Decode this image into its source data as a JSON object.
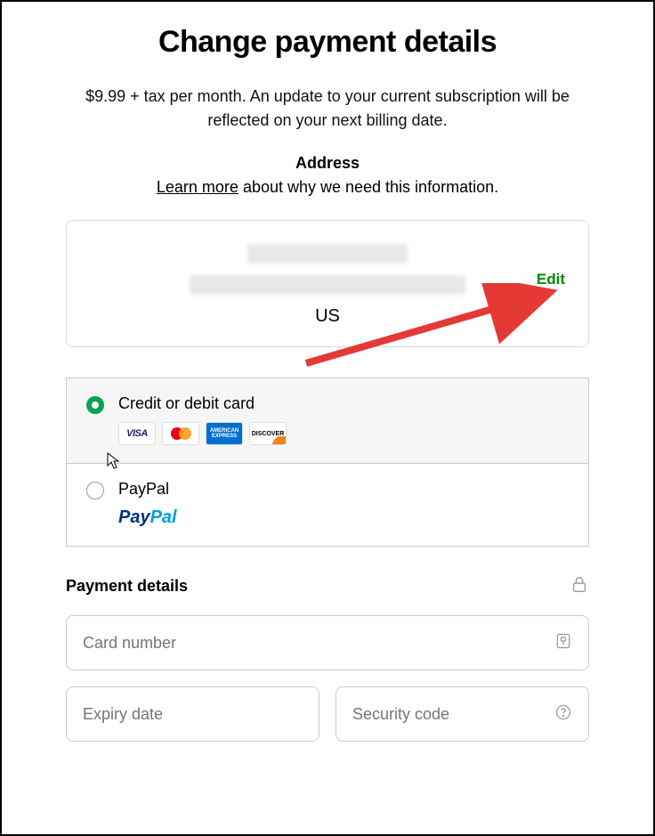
{
  "title": "Change payment details",
  "subtitle": "$9.99 + tax per month. An update to your current subscription will be reflected on your next billing date.",
  "address": {
    "heading": "Address",
    "learn_more_text": "Learn more",
    "learn_more_rest": " about why we need this information.",
    "country": "US",
    "edit_label": "Edit"
  },
  "payment_methods": {
    "card_label": "Credit or debit card",
    "paypal_label": "PayPal",
    "logos": {
      "visa": "VISA",
      "amex": "AMERICAN EXPRESS",
      "discover": "DISCOVER"
    }
  },
  "details": {
    "heading": "Payment details",
    "card_placeholder": "Card number",
    "expiry_placeholder": "Expiry date",
    "cvc_placeholder": "Security code"
  }
}
